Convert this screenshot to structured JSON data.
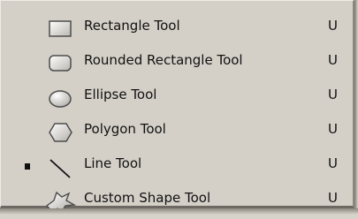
{
  "menu": {
    "items": [
      {
        "label": "Rectangle Tool",
        "shortcut": "U",
        "icon": "rectangle-icon",
        "selected": false
      },
      {
        "label": "Rounded Rectangle Tool",
        "shortcut": "U",
        "icon": "rounded-rectangle-icon",
        "selected": false
      },
      {
        "label": "Ellipse Tool",
        "shortcut": "U",
        "icon": "ellipse-icon",
        "selected": false
      },
      {
        "label": "Polygon Tool",
        "shortcut": "U",
        "icon": "polygon-icon",
        "selected": false
      },
      {
        "label": "Line Tool",
        "shortcut": "U",
        "icon": "line-icon",
        "selected": true
      },
      {
        "label": "Custom Shape Tool",
        "shortcut": "U",
        "icon": "custom-shape-icon",
        "selected": false
      }
    ]
  }
}
